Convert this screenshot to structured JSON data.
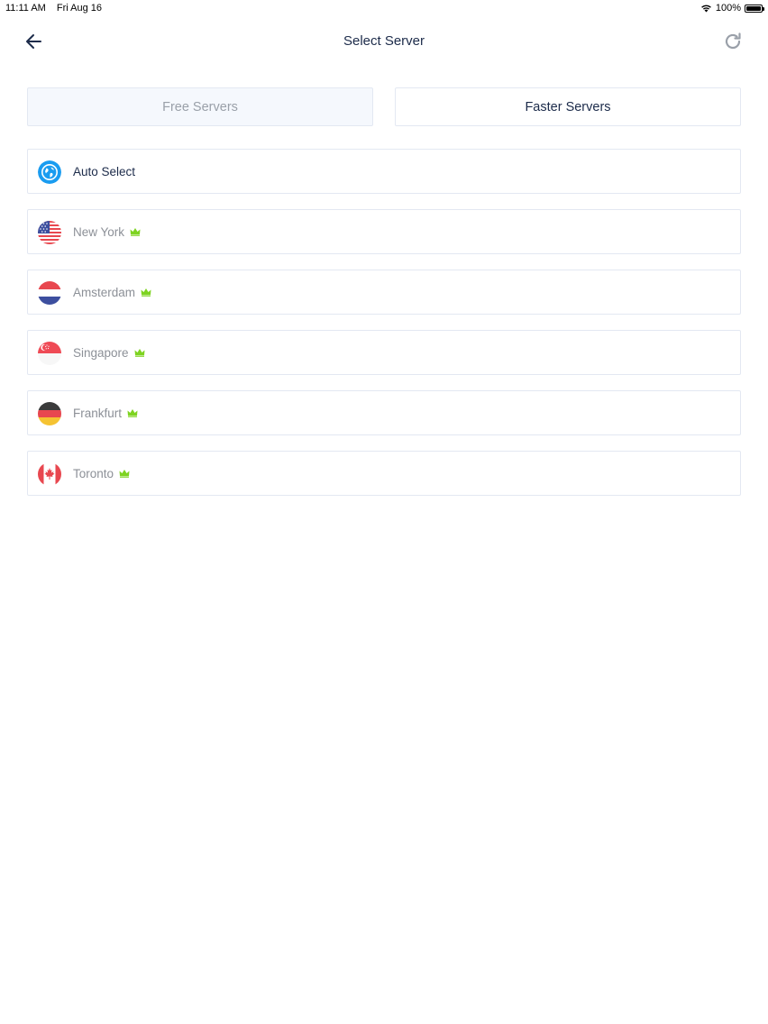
{
  "status_bar": {
    "time": "11:11 AM",
    "date": "Fri Aug 16",
    "battery": "100%"
  },
  "nav": {
    "title": "Select Server"
  },
  "tabs": [
    {
      "label": "Free Servers",
      "selected": false
    },
    {
      "label": "Faster Servers",
      "selected": true
    }
  ],
  "auto_select": {
    "label": "Auto Select",
    "icon": "globe-icon"
  },
  "servers": [
    {
      "name": "New York",
      "flag": "us-flag-icon",
      "premium": true
    },
    {
      "name": "Amsterdam",
      "flag": "nl-flag-icon",
      "premium": true
    },
    {
      "name": "Singapore",
      "flag": "sg-flag-icon",
      "premium": true
    },
    {
      "name": "Frankfurt",
      "flag": "de-flag-icon",
      "premium": true
    },
    {
      "name": "Toronto",
      "flag": "ca-flag-icon",
      "premium": true
    }
  ],
  "colors": {
    "accent": "#1a9cf0",
    "crown": "#7ed321",
    "text_dark": "#1c2b4a",
    "text_muted": "#8c9097",
    "border": "#e3e8f2"
  }
}
